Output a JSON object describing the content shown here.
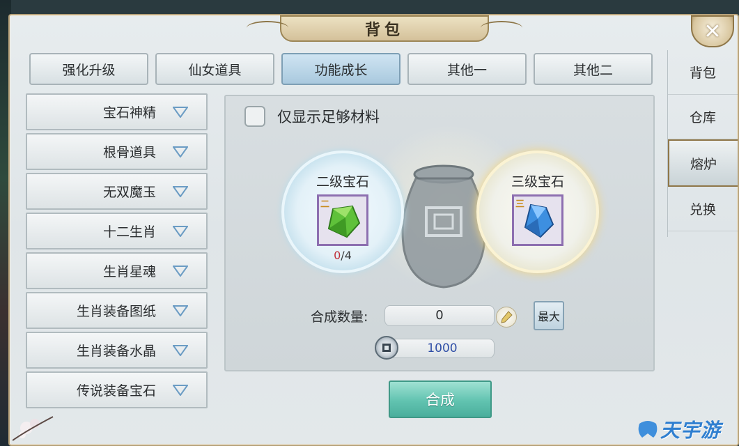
{
  "window": {
    "title": "背包",
    "close_label": "✕"
  },
  "tabs": [
    {
      "label": "强化升级",
      "active": false
    },
    {
      "label": "仙女道具",
      "active": false
    },
    {
      "label": "功能成长",
      "active": true
    },
    {
      "label": "其他一",
      "active": false
    },
    {
      "label": "其他二",
      "active": false
    }
  ],
  "sidenav": [
    {
      "label": "背包",
      "active": false
    },
    {
      "label": "仓库",
      "active": false
    },
    {
      "label": "熔炉",
      "active": true
    },
    {
      "label": "兑换",
      "active": false
    }
  ],
  "categories": [
    {
      "label": "宝石神精"
    },
    {
      "label": "根骨道具"
    },
    {
      "label": "无双魔玉"
    },
    {
      "label": "十二生肖"
    },
    {
      "label": "生肖星魂"
    },
    {
      "label": "生肖装备图纸"
    },
    {
      "label": "生肖装备水晶"
    },
    {
      "label": "传说装备宝石"
    }
  ],
  "forge": {
    "filter_label": "仅显示足够材料",
    "filter_checked": false,
    "source": {
      "title": "二级宝石",
      "have": "0",
      "sep": "/",
      "need": "4",
      "badge": "二",
      "color": "#5fc13a"
    },
    "target": {
      "title": "三级宝石",
      "badge": "三",
      "color": "#3d8fe0"
    },
    "quantity_label": "合成数量:",
    "quantity_value": "0",
    "max_label": "最大",
    "cost_value": "1000",
    "compose_label": "合成"
  },
  "watermark": {
    "text": "天宇游"
  },
  "colors": {
    "accent_gold": "#b7a27a",
    "compose_green": "#61c3b0",
    "cost_blue": "#2f4ea6",
    "deficit_red": "#c0303a"
  }
}
